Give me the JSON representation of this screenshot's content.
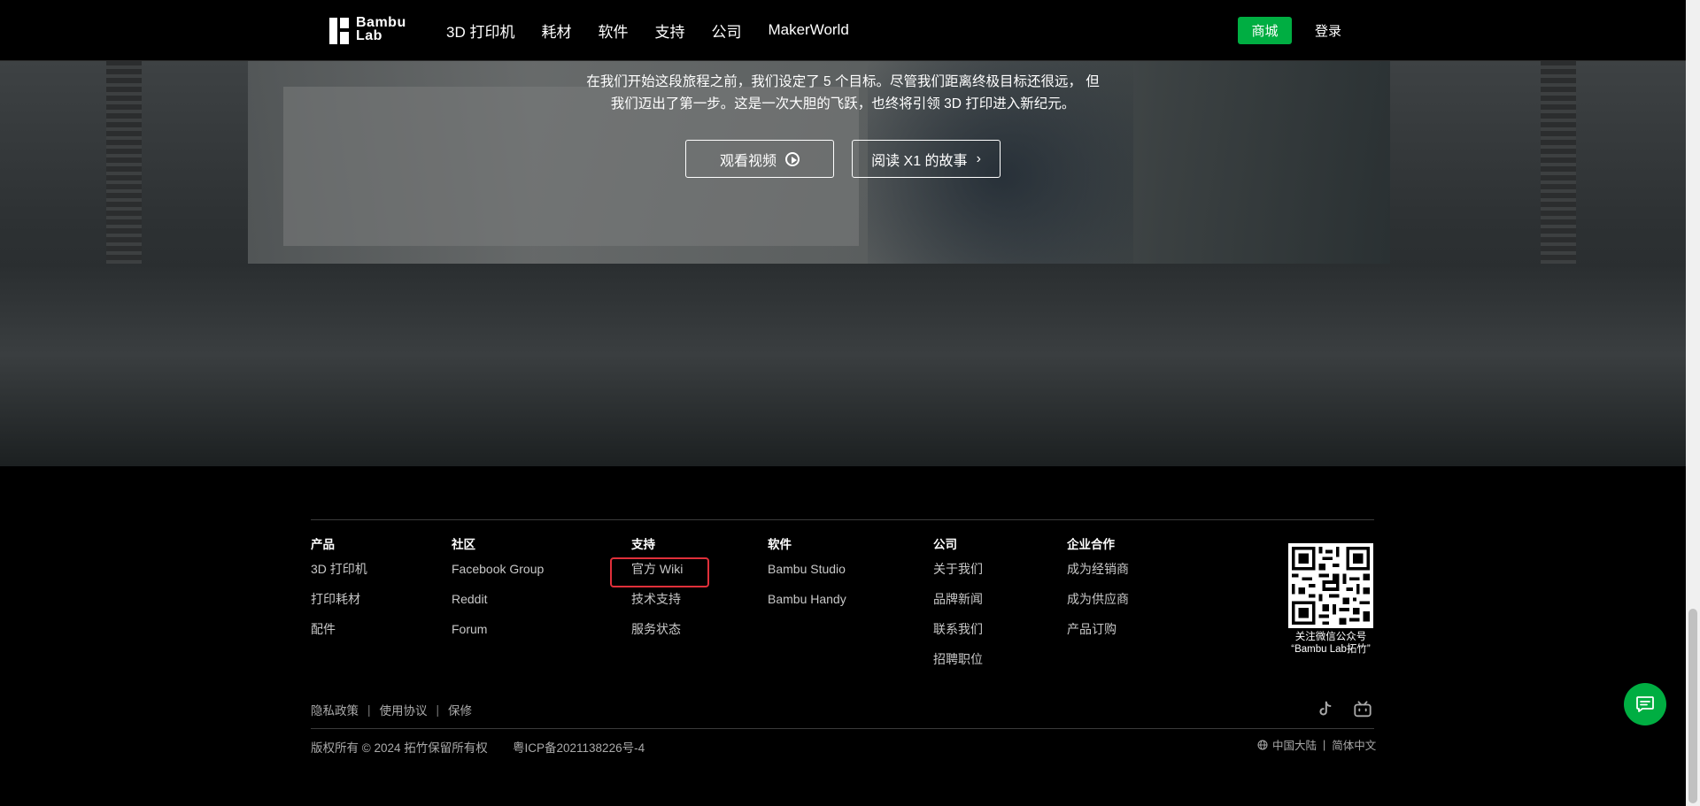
{
  "nav": {
    "logo_line1": "Bambu",
    "logo_line2": "Lab",
    "links": [
      "3D 打印机",
      "耗材",
      "软件",
      "支持",
      "公司",
      "MakerWorld"
    ],
    "shop_label": "商城",
    "login_label": "登录"
  },
  "hero": {
    "line1": "在我们开始这段旅程之前，我们设定了 5 个目标。尽管我们距离终极目标还很远， 但",
    "line2": "我们迈出了第一步。这是一次大胆的飞跃，也终将引领 3D 打印进入新纪元。",
    "watch_video_label": "观看视频",
    "read_story_label": "阅读 X1 的故事"
  },
  "footer": {
    "columns": [
      {
        "title": "产品",
        "items": [
          "3D 打印机",
          "打印耗材",
          "配件"
        ]
      },
      {
        "title": "社区",
        "items": [
          "Facebook Group",
          "Reddit",
          "Forum"
        ]
      },
      {
        "title": "支持",
        "items": [
          "官方 Wiki",
          "技术支持",
          "服务状态"
        ]
      },
      {
        "title": "软件",
        "items": [
          "Bambu Studio",
          "Bambu Handy"
        ]
      },
      {
        "title": "公司",
        "items": [
          "关于我们",
          "品牌新闻",
          "联系我们",
          "招聘职位"
        ]
      },
      {
        "title": "企业合作",
        "items": [
          "成为经销商",
          "成为供应商",
          "产品订购"
        ]
      }
    ],
    "qr_caption_line1": "关注微信公众号",
    "qr_caption_line2": "“Bambu Lab拓竹”",
    "legal_links": [
      "隐私政策",
      "使用协议",
      "保修"
    ],
    "copyright": "版权所有 © 2024 拓竹保留所有权",
    "icp": "粤ICP备2021138226号-4",
    "region": "中国大陆",
    "language": "简体中文",
    "social_icons": [
      "tiktok-icon",
      "bilibili-icon"
    ]
  },
  "colors": {
    "accent": "#00ae42",
    "highlight": "#e0303a"
  }
}
